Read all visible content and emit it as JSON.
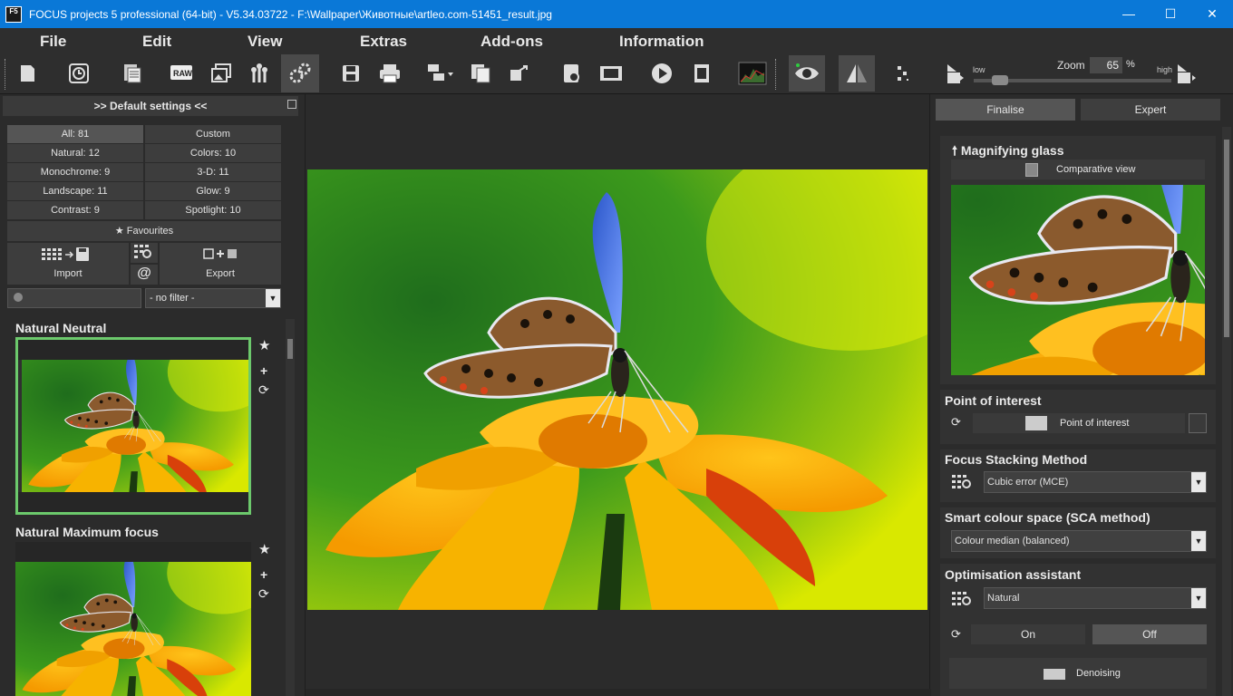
{
  "window": {
    "logo": "F5",
    "title": "FOCUS projects 5 professional (64-bit) - V5.34.03722 - F:\\Wallpaper\\Животные\\artleo.com-51451_result.jpg",
    "minimize": "—",
    "maximize": "☐",
    "close": "✕"
  },
  "menu": {
    "file": "File",
    "edit": "Edit",
    "view": "View",
    "extras": "Extras",
    "addons": "Add-ons",
    "information": "Information"
  },
  "zoom": {
    "label": "Zoom",
    "value": "65",
    "unit": "%",
    "low": "low",
    "high": "high",
    "slider_fraction": 0.1
  },
  "left": {
    "header": ">> Default settings <<",
    "categories": [
      {
        "label": "All: 81",
        "selected": true
      },
      {
        "label": "Custom",
        "selected": false
      },
      {
        "label": "Natural: 12",
        "selected": false
      },
      {
        "label": "Colors: 10",
        "selected": false
      },
      {
        "label": "Monochrome: 9",
        "selected": false
      },
      {
        "label": "3-D: 11",
        "selected": false
      },
      {
        "label": "Landscape: 11",
        "selected": false
      },
      {
        "label": "Glow: 9",
        "selected": false
      },
      {
        "label": "Contrast: 9",
        "selected": false
      },
      {
        "label": "Spotlight: 10",
        "selected": false
      }
    ],
    "favourites": "Favourites",
    "import": "Import",
    "at": "@",
    "export": "Export",
    "filter": "- no filter -",
    "presets": [
      {
        "title": "Natural Neutral"
      },
      {
        "title": "Natural Maximum focus"
      }
    ]
  },
  "right": {
    "tabs": [
      "Finalise",
      "Expert"
    ],
    "magnifier": {
      "title": "Magnifying glass",
      "comparative": "Comparative view"
    },
    "poi": {
      "title": "Point of interest",
      "button": "Point of interest"
    },
    "stacking": {
      "title": "Focus Stacking Method",
      "value": "Cubic error (MCE)"
    },
    "sca": {
      "title": "Smart colour space (SCA method)",
      "value": "Colour median (balanced)"
    },
    "optimisation": {
      "title": "Optimisation assistant",
      "value": "Natural",
      "on": "On",
      "off": "Off"
    },
    "denoising": "Denoising"
  },
  "colors": {
    "titlebar": "#0a78d7",
    "selected_frame": "#6cc96c"
  }
}
